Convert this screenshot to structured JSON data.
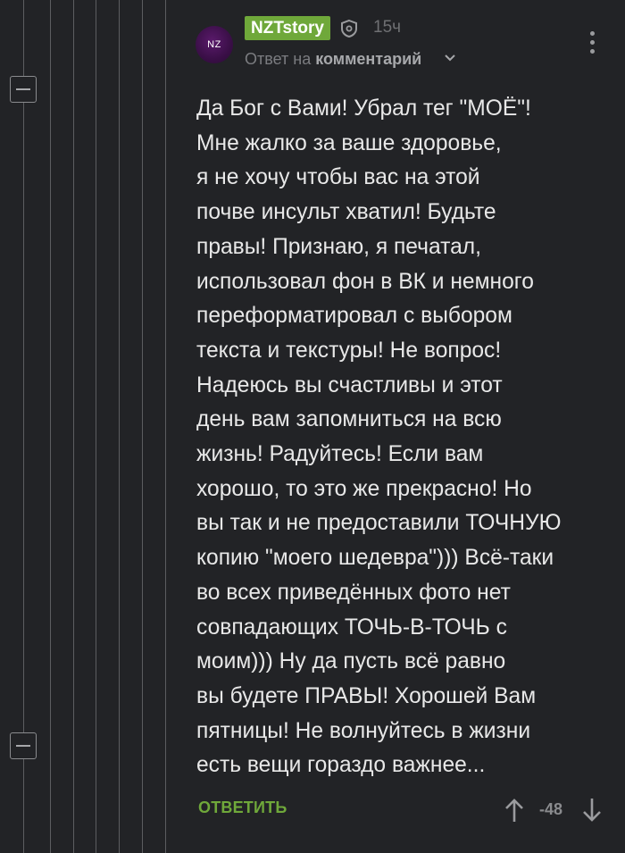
{
  "comment": {
    "avatar_initials": "NZ",
    "username": "NZTstory",
    "time": "15ч",
    "reply_prefix": "Ответ на ",
    "reply_target": "комментарий",
    "text": "Да Бог с Вами! Убрал тег \"МОЁ\"!\nМне жалко за ваше здоровье,\nя не хочу чтобы вас на этой\nпочве инсульт хватил! Будьте\nправы! Признаю, я печатал,\nиспользовал фон в ВК и немного\nпереформатировал с выбором\nтекста и текстуры! Не вопрос!\nНадеюсь вы счастливы и этот\nдень вам запомниться на всю\nжизнь! Радуйтесь! Если вам\nхорошо, то это же прекрасно! Но\nвы так и не предоставили ТОЧНУЮ\nкопию \"моего шедевра\"))) Всё-таки\nво всех приведённых фото нет\nсовпадающих ТОЧЬ-В-ТОЧЬ с\nмоим))) Ну да пусть всё равно\nвы будете ПРАВЫ! Хорошей Вам\nпятницы! Не волнуйтесь в жизни\nесть вещи гораздо важнее...",
    "reply_label": "ОТВЕТИТЬ",
    "rating": "-48"
  },
  "icons": {
    "shield": "shield-icon",
    "chevron": "chevron-down-icon",
    "more": "more-vertical-icon",
    "up": "arrow-up-icon",
    "down": "arrow-down-icon",
    "collapse": "minus-icon"
  },
  "colors": {
    "background": "#222326",
    "accent_green": "#6fa83a",
    "text": "#e8e8e8",
    "muted": "#7b7c80",
    "thread_line": "#5c5d60"
  }
}
